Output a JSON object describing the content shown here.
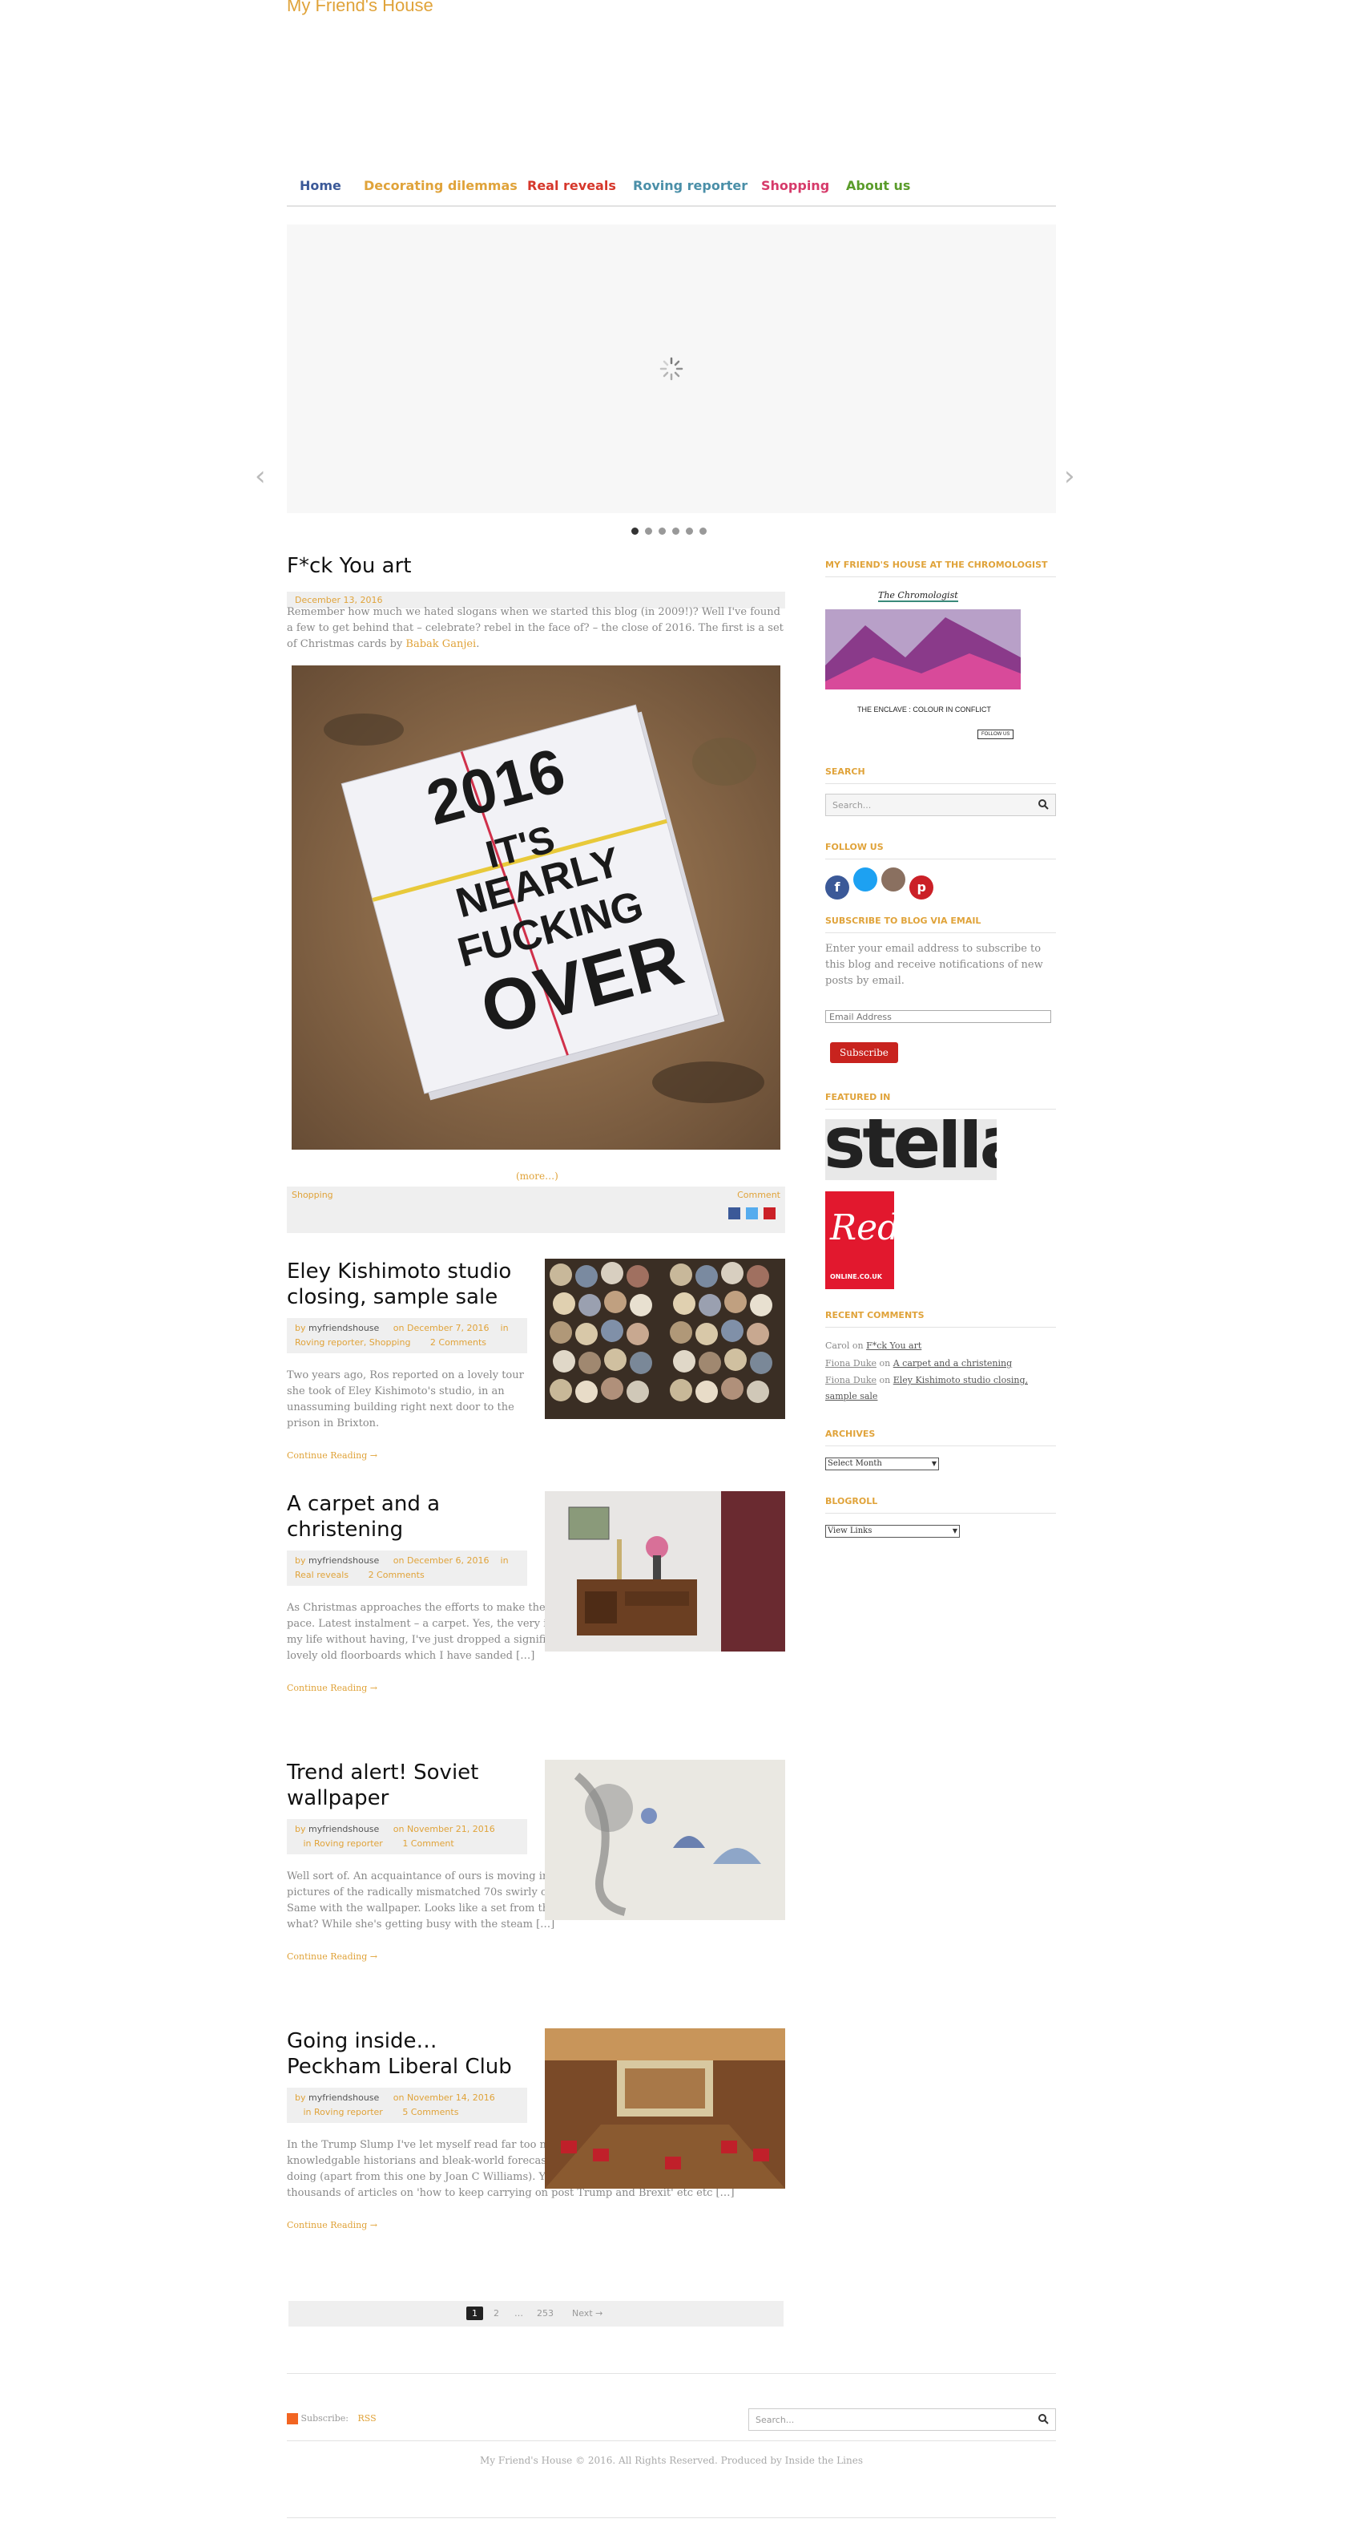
{
  "site": {
    "title": "My Friend's House"
  },
  "nav": [
    {
      "label": "Home",
      "color": "#3b5998"
    },
    {
      "label": "Decorating dilemmas",
      "color": "#e0a33a"
    },
    {
      "label": "Real reveals",
      "color": "#d6372b"
    },
    {
      "label": "Roving reporter",
      "color": "#4a8fa8"
    },
    {
      "label": "Shopping",
      "color": "#d63a6a"
    },
    {
      "label": "About us",
      "color": "#5a9c2a"
    }
  ],
  "slider": {
    "slides": 6,
    "active": 1
  },
  "featured": {
    "title": "F*ck You art",
    "date": "December 13, 2016",
    "excerpt_1": "Remember how much we hated slogans when we started this blog (in 2009!)? Well I've found a few to get behind that – celebrate? rebel in the face of? – the close of 2016. The first is a set of Christmas cards by",
    "excerpt_link": "Babak Ganjei",
    "excerpt_end": ".",
    "card_lines": [
      "2016",
      "IT'S",
      "NEARLY",
      "FUCKING",
      "OVER"
    ],
    "more": "(more…)",
    "category": "Shopping",
    "comment": "Comment"
  },
  "posts": [
    {
      "title": "Eley Kishimoto studio closing, sample sale",
      "by": "by",
      "author": "myfriendshouse",
      "on": "on December 7, 2016",
      "in": "in",
      "cats": "Roving reporter, Shopping",
      "comments": "2 Comments",
      "excerpt": "Two years ago, Ros reported on a lovely tour she took of Eley Kishimoto's studio, in an unassuming building right next door to the prison in Brixton.",
      "readmore": "Continue Reading →"
    },
    {
      "title": "A carpet and a christening",
      "by": "by",
      "author": "myfriendshouse",
      "on": "on December 6, 2016",
      "in": "in",
      "cats": "Real reveals",
      "comments": "2 Comments",
      "excerpt": "As Christmas approaches the efforts to make the house warm and respectable gather pace. Latest instalment – a carpet. Yes, the very item of decor I thought I'd go the rest of my life without having, I've just dropped a significant amount of money on. The house has lovely old floorboards which I have sanded […]",
      "readmore": "Continue Reading →"
    },
    {
      "title": "Trend alert! Soviet wallpaper",
      "by": "by",
      "author": "myfriendshouse",
      "on": "on November 21, 2016",
      "in": "in",
      "cats": "Roving reporter",
      "comments": "1 Comment",
      "excerpt": "Well sort of. An acquaintance of ours is moving into a do-er up-er and sharing on FB pictures of the radically mismatched 70s swirly carpets, a different pattern in each room. Same with the wallpaper. Looks like a set from the Albert Square B&B. And you know what? While she's getting busy with the steam […]",
      "readmore": "Continue Reading →"
    },
    {
      "title": "Going inside…Peckham Liberal Club",
      "by": "by",
      "author": "myfriendshouse",
      "on": "on November 14, 2016",
      "in": "in",
      "cats": "Roving reporter",
      "comments": "5 Comments",
      "excerpt": "In the Trump Slump I've let myself read far too many terrifying articles from knowledgable historians and bleak-world forecaster John Pilger, which I don't recommend doing (apart from this one by Joan C Williams). You may have too. Anyway, amid the thousands of articles on 'how to keep carrying on post Trump and Brexit' etc etc […]",
      "readmore": "Continue Reading →"
    }
  ],
  "pagination": {
    "current": "1",
    "page2": "2",
    "dots": "…",
    "last": "253",
    "next": "Next →"
  },
  "sidebar": {
    "chromologist_heading": "My Friend's House at the Chromologist",
    "chromologist_logo": "The Chromologist",
    "chromologist_caption": "THE ENCLAVE : COLOUR IN CONFLICT",
    "chromologist_follow": "FOLLOW US",
    "search_heading": "Search",
    "search_placeholder": "Search...",
    "follow_heading": "Follow us",
    "subscribe_heading": "Subscribe to Blog via Email",
    "subscribe_text": "Enter your email address to subscribe to this blog and receive notifications of new posts by email.",
    "email_placeholder": "Email Address",
    "subscribe_button": "Subscribe",
    "featured_heading": "Featured in",
    "stella": "stella",
    "red": "Red",
    "red_sub": "ONLINE.CO.UK",
    "recent_heading": "Recent Comments",
    "recent": [
      {
        "author": "Carol",
        "on": "on",
        "post": "F*ck You art"
      },
      {
        "author": "Fiona Duke",
        "on": "on",
        "post": "A carpet and a christening"
      },
      {
        "author": "Fiona Duke",
        "on": "on",
        "post": "Eley Kishimoto studio closing, sample sale"
      }
    ],
    "archives_heading": "Archives",
    "archives_select": "Select Month",
    "blogroll_heading": "Blogroll",
    "blogroll_select": "View Links"
  },
  "footer": {
    "subscribe": "Subscribe:",
    "rss": "RSS",
    "search_placeholder": "Search...",
    "copyright": "My Friend's House © 2016. All Rights Reserved. Produced by Inside the Lines"
  },
  "icons": {
    "facebook": "facebook-icon",
    "twitter": "twitter-icon",
    "instagram": "instagram-icon",
    "pinterest": "pinterest-icon",
    "search": "search-icon",
    "rss": "rss-icon"
  }
}
